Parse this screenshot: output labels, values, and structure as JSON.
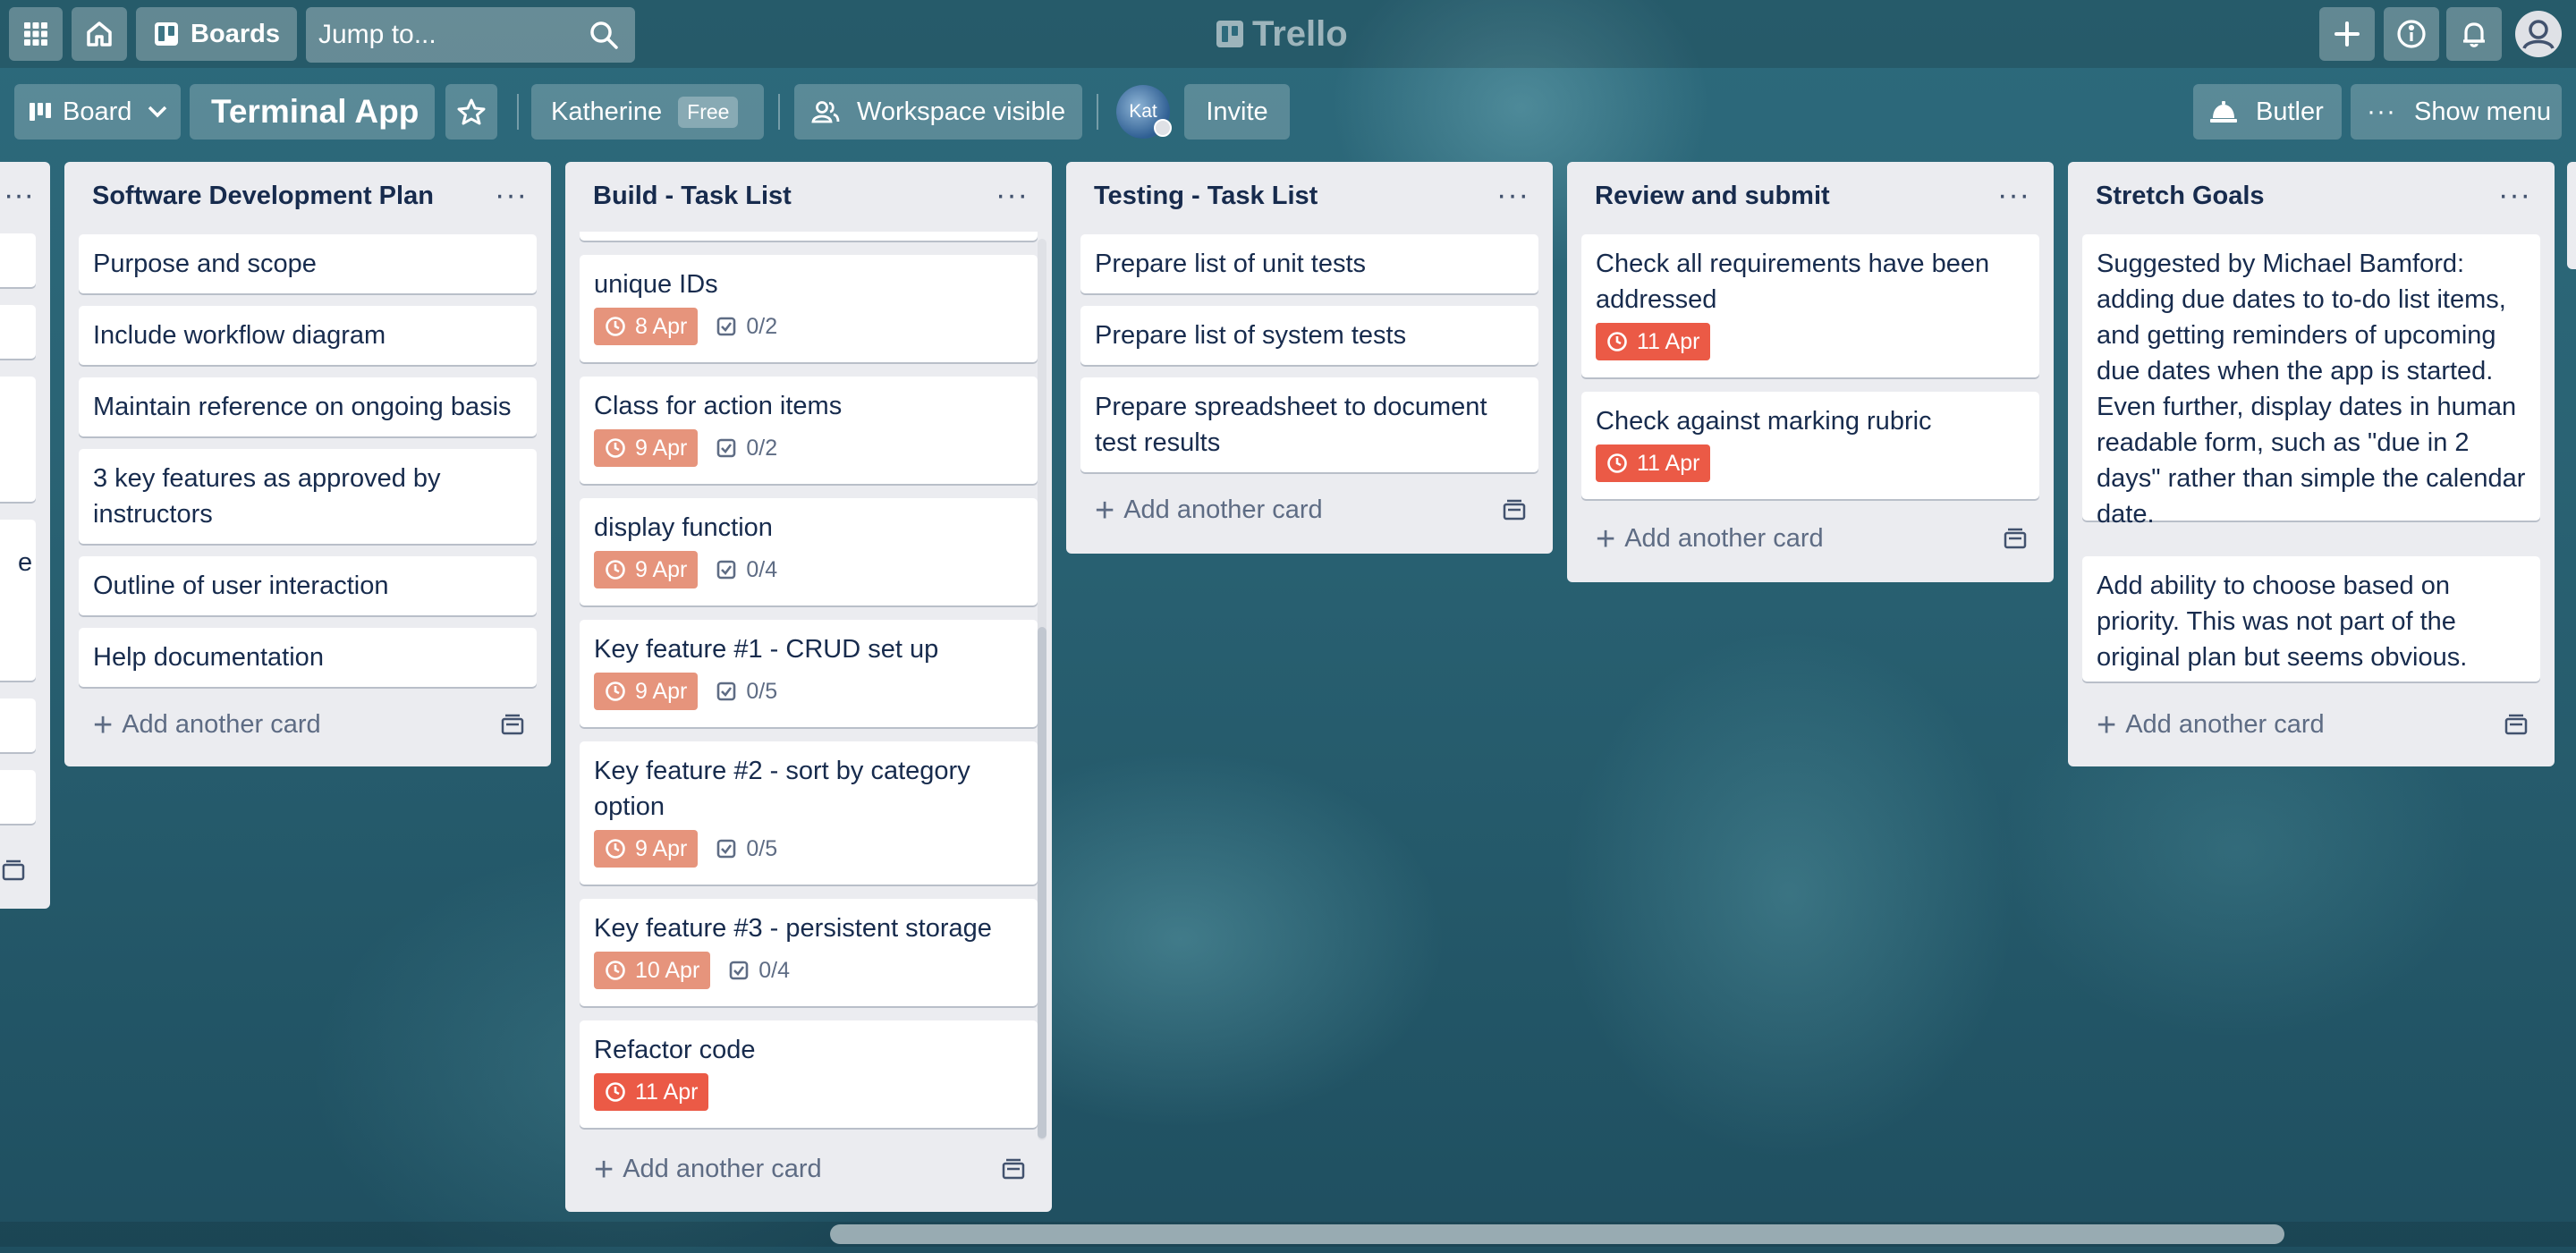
{
  "header": {
    "boards_label": "Boards",
    "search_placeholder": "Jump to...",
    "logo": "Trello"
  },
  "board": {
    "view_label": "Board",
    "title": "Terminal App",
    "workspace_name": "Katherine",
    "plan_badge": "Free",
    "visibility_label": "Workspace visible",
    "avatar_initials": "Kat",
    "invite_label": "Invite",
    "butler_label": "Butler",
    "menu_label": "Show menu"
  },
  "lists": [
    {
      "title": "Software Development Plan",
      "cards": [
        {
          "title": "Purpose and scope"
        },
        {
          "title": "Include workflow diagram"
        },
        {
          "title": "Maintain reference on ongoing basis"
        },
        {
          "title": "3 key features as approved by instructors"
        },
        {
          "title": "Outline of user interaction"
        },
        {
          "title": "Help documentation"
        }
      ],
      "add_label": "Add another card"
    },
    {
      "title": "Build - Task List",
      "cards": [
        {
          "title": "unique IDs",
          "due": "8 Apr",
          "checklist": "0/2"
        },
        {
          "title": "Class for action items",
          "due": "9 Apr",
          "checklist": "0/2"
        },
        {
          "title": "display function",
          "due": "9 Apr",
          "checklist": "0/4"
        },
        {
          "title": "Key feature #1 - CRUD set up",
          "due": "9 Apr",
          "checklist": "0/5"
        },
        {
          "title": "Key feature #2 - sort by category option",
          "due": "9 Apr",
          "checklist": "0/5"
        },
        {
          "title": "Key feature #3 - persistent storage",
          "due": "10 Apr",
          "checklist": "0/4"
        },
        {
          "title": "Refactor code",
          "due": "11 Apr"
        }
      ],
      "add_label": "Add another card"
    },
    {
      "title": "Testing - Task List",
      "cards": [
        {
          "title": "Prepare list of unit tests"
        },
        {
          "title": "Prepare list of system tests"
        },
        {
          "title": "Prepare spreadsheet to document test results"
        }
      ],
      "add_label": "Add another card"
    },
    {
      "title": "Review and submit",
      "cards": [
        {
          "title": "Check all requirements have been addressed",
          "due": "11 Apr"
        },
        {
          "title": "Check against marking rubric",
          "due": "11 Apr"
        }
      ],
      "add_label": "Add another card"
    },
    {
      "title": "Stretch Goals",
      "cards": [
        {
          "title": "Suggested by Michael Bamford: adding due dates to to-do list items, and getting reminders of upcoming due dates when the app is started. Even further, display dates in human readable form, such as \"due in 2 days\" rather than simple the calendar date."
        },
        {
          "title": "Add ability to choose based on priority. This was not part of the original plan but seems obvious."
        }
      ],
      "add_label": "Add another card"
    }
  ],
  "partial_list": {
    "title_fragment": "e"
  },
  "colors": {
    "due_soon": "#e6947c",
    "due_overdue": "#eb5a46",
    "list_bg": "#ebecf0",
    "text": "#172b4d"
  }
}
